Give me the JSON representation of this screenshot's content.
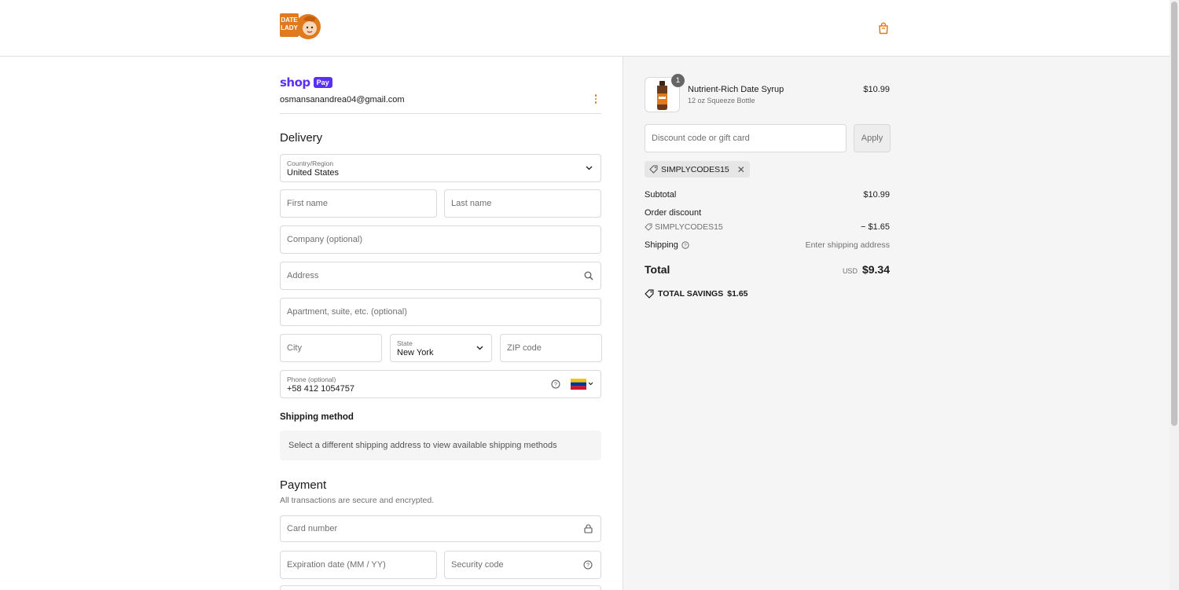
{
  "header": {
    "logo_text_1": "DATE",
    "logo_text_2": "LADY",
    "brand_color": "#e07a1f"
  },
  "shop_pay": {
    "word": "shop",
    "pill": "Pay",
    "email": "osmansanandrea04@gmail.com"
  },
  "delivery": {
    "title": "Delivery",
    "country_label": "Country/Region",
    "country_value": "United States",
    "first_name_ph": "First name",
    "last_name_ph": "Last name",
    "company_ph": "Company (optional)",
    "address_ph": "Address",
    "apartment_ph": "Apartment, suite, etc. (optional)",
    "city_ph": "City",
    "state_label": "State",
    "state_value": "New York",
    "zip_ph": "ZIP code",
    "phone_label": "Phone (optional)",
    "phone_value": "+58 412 1054757"
  },
  "shipping_method": {
    "title": "Shipping method",
    "notice": "Select a different shipping address to view available shipping methods"
  },
  "payment": {
    "title": "Payment",
    "subtitle": "All transactions are secure and encrypted.",
    "card_number_ph": "Card number",
    "expiration_ph": "Expiration date (MM / YY)",
    "security_ph": "Security code"
  },
  "summary": {
    "item": {
      "quantity": "1",
      "name": "Nutrient-Rich Date Syrup",
      "variant": "12 oz Squeeze Bottle",
      "price": "$10.99"
    },
    "discount_ph": "Discount code or gift card",
    "apply_label": "Apply",
    "applied_code": "SIMPLYCODES15",
    "subtotal_label": "Subtotal",
    "subtotal_value": "$10.99",
    "order_discount_label": "Order discount",
    "order_discount_code": "SIMPLYCODES15",
    "order_discount_value": "− $1.65",
    "shipping_label": "Shipping",
    "shipping_value": "Enter shipping address",
    "total_label": "Total",
    "total_currency": "USD",
    "total_value": "$9.34",
    "savings_label": "TOTAL SAVINGS",
    "savings_value": "$1.65"
  }
}
